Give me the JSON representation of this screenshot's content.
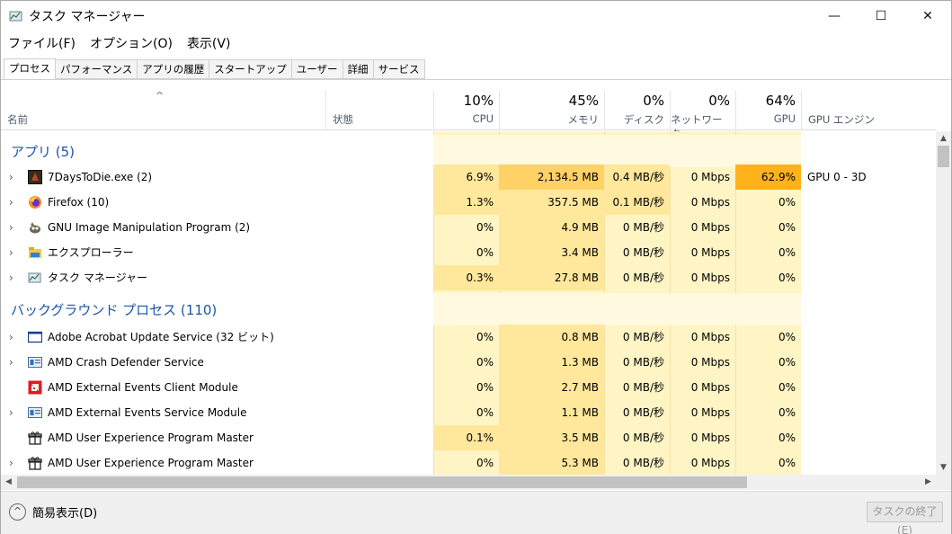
{
  "window": {
    "title": "タスク マネージャー",
    "minimize": "—",
    "maximize": "☐",
    "close": "✕"
  },
  "menu": [
    "ファイル(F)",
    "オプション(O)",
    "表示(V)"
  ],
  "tabs": [
    "プロセス",
    "パフォーマンス",
    "アプリの履歴",
    "スタートアップ",
    "ユーザー",
    "詳細",
    "サービス"
  ],
  "columns": {
    "sort_glyph": "^",
    "name": "名前",
    "status": "状態",
    "cpu": {
      "pct": "10%",
      "label": "CPU"
    },
    "mem": {
      "pct": "45%",
      "label": "メモリ"
    },
    "disk": {
      "pct": "0%",
      "label": "ディスク"
    },
    "net": {
      "pct": "0%",
      "label": "ネットワーク"
    },
    "gpu": {
      "pct": "64%",
      "label": "GPU"
    },
    "gpu_engine": "GPU エンジン"
  },
  "groups": {
    "apps": "アプリ (5)",
    "background": "バックグラウンド プロセス (110)"
  },
  "apps": [
    {
      "name": "7DaysToDie.exe (2)",
      "icon": "game-icon",
      "expand": "›",
      "cpu": "6.9%",
      "mem": "2,134.5 MB",
      "disk": "0.4 MB/秒",
      "net": "0 Mbps",
      "gpu": "62.9%",
      "engine": "GPU 0 - 3D"
    },
    {
      "name": "Firefox (10)",
      "icon": "firefox-icon",
      "expand": "›",
      "cpu": "1.3%",
      "mem": "357.5 MB",
      "disk": "0.1 MB/秒",
      "net": "0 Mbps",
      "gpu": "0%",
      "engine": ""
    },
    {
      "name": "GNU Image Manipulation Program (2)",
      "icon": "gimp-icon",
      "expand": "›",
      "cpu": "0%",
      "mem": "4.9 MB",
      "disk": "0 MB/秒",
      "net": "0 Mbps",
      "gpu": "0%",
      "engine": ""
    },
    {
      "name": "エクスプローラー",
      "icon": "folder-icon",
      "expand": "›",
      "cpu": "0%",
      "mem": "3.4 MB",
      "disk": "0 MB/秒",
      "net": "0 Mbps",
      "gpu": "0%",
      "engine": ""
    },
    {
      "name": "タスク マネージャー",
      "icon": "taskmgr-icon",
      "expand": "›",
      "cpu": "0.3%",
      "mem": "27.8 MB",
      "disk": "0 MB/秒",
      "net": "0 Mbps",
      "gpu": "0%",
      "engine": ""
    }
  ],
  "background": [
    {
      "name": "Adobe Acrobat Update Service (32 ビット)",
      "icon": "window-icon",
      "expand": "›",
      "cpu": "0%",
      "mem": "0.8 MB",
      "disk": "0 MB/秒",
      "net": "0 Mbps",
      "gpu": "0%"
    },
    {
      "name": "AMD Crash Defender Service",
      "icon": "service-icon",
      "expand": "›",
      "cpu": "0%",
      "mem": "1.3 MB",
      "disk": "0 MB/秒",
      "net": "0 Mbps",
      "gpu": "0%"
    },
    {
      "name": "AMD External Events Client Module",
      "icon": "amd-icon",
      "expand": "",
      "cpu": "0%",
      "mem": "2.7 MB",
      "disk": "0 MB/秒",
      "net": "0 Mbps",
      "gpu": "0%"
    },
    {
      "name": "AMD External Events Service Module",
      "icon": "service-icon",
      "expand": "›",
      "cpu": "0%",
      "mem": "1.1 MB",
      "disk": "0 MB/秒",
      "net": "0 Mbps",
      "gpu": "0%"
    },
    {
      "name": "AMD User Experience Program Master",
      "icon": "gift-icon",
      "expand": "",
      "cpu": "0.1%",
      "mem": "3.5 MB",
      "disk": "0 MB/秒",
      "net": "0 Mbps",
      "gpu": "0%"
    },
    {
      "name": "AMD User Experience Program Master",
      "icon": "gift-icon",
      "expand": "›",
      "cpu": "0%",
      "mem": "5.3 MB",
      "disk": "0 MB/秒",
      "net": "0 Mbps",
      "gpu": "0%"
    }
  ],
  "footer": {
    "fewer": "簡易表示(D)",
    "fewer_glyph": "^",
    "end_task": "タスクの終了(E)"
  }
}
